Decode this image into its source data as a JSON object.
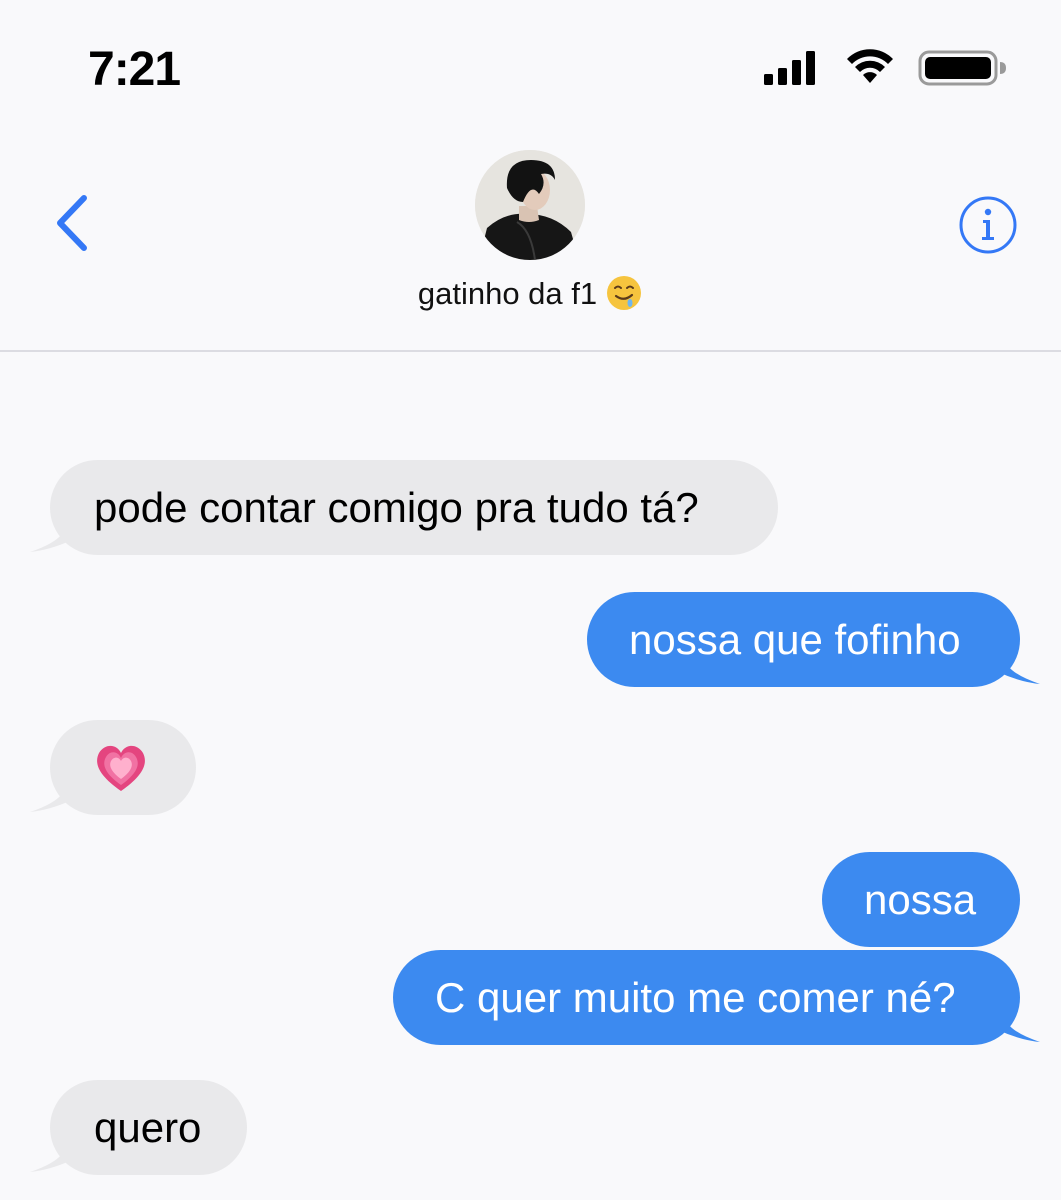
{
  "status_bar": {
    "time": "7:21",
    "signal_icon": "cellular-signal-icon",
    "wifi_icon": "wifi-icon",
    "battery_icon": "battery-full-icon"
  },
  "header": {
    "back_icon": "chevron-left-icon",
    "contact_name": "gatinho da f1",
    "contact_emoji": "drooling-face-emoji",
    "info_icon": "info-circle-icon"
  },
  "messages": [
    {
      "direction": "incoming",
      "text": "pode contar comigo pra tudo tá?"
    },
    {
      "direction": "outgoing",
      "text": "nossa que fofinho"
    },
    {
      "direction": "incoming",
      "text": "",
      "emoji": "growing-heart-emoji"
    },
    {
      "direction": "outgoing",
      "text": "nossa"
    },
    {
      "direction": "outgoing",
      "text": "C quer muito me comer né?"
    },
    {
      "direction": "incoming",
      "text": "quero"
    }
  ],
  "colors": {
    "accent": "#3478f6",
    "outgoing_bubble": "#3c8af0",
    "incoming_bubble": "#e9e9eb",
    "background": "#f9f9fb",
    "divider": "#dcdce2"
  }
}
